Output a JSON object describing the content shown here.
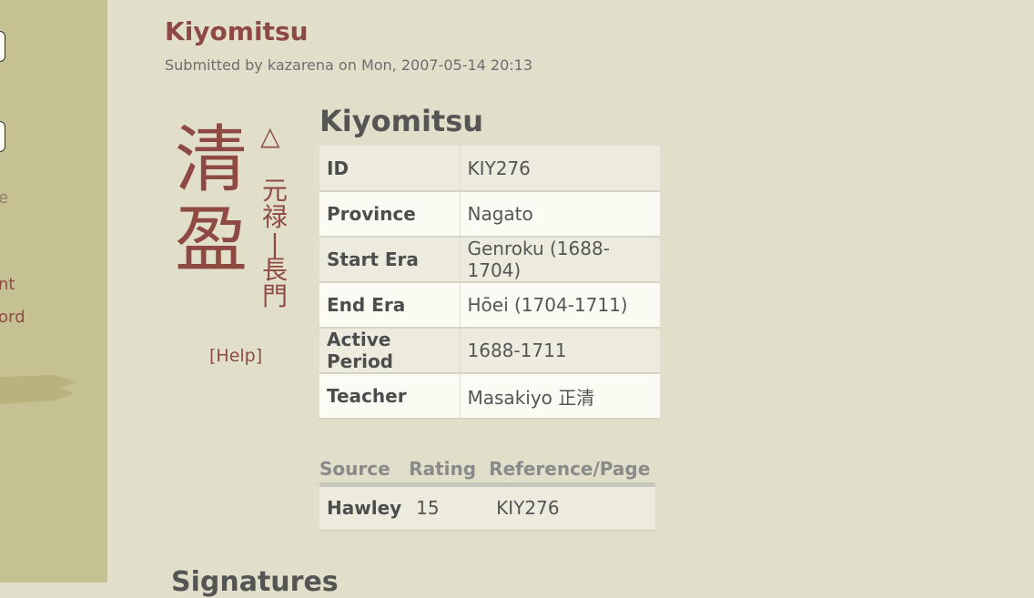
{
  "sidebar": {
    "link_partial_1": "e",
    "link_partial_2": "nt",
    "link_partial_3": "ord"
  },
  "page": {
    "title": "Kiyomitsu",
    "submitted": "Submitted by kazarena on Mon, 2007-05-14 20:13"
  },
  "signature_image": {
    "main": [
      "清",
      "盈"
    ],
    "triangle": "△",
    "vertical": [
      "元",
      "禄",
      "|",
      "長",
      "門"
    ],
    "help": "[Help]"
  },
  "entry": {
    "heading": "Kiyomitsu",
    "rows": [
      {
        "label": "ID",
        "value": "KIY276"
      },
      {
        "label": "Province",
        "value": "Nagato"
      },
      {
        "label": "Start Era",
        "value": "Genroku (1688-1704)"
      },
      {
        "label": "End Era",
        "value": "Hōei (1704-1711)"
      },
      {
        "label": "Active Period",
        "value": "1688-1711"
      },
      {
        "label": "Teacher",
        "value": "Masakiyo 正清"
      }
    ]
  },
  "references": {
    "headers": {
      "source": "Source",
      "rating": "Rating",
      "reference": "Reference/Page"
    },
    "rows": [
      {
        "source": "Hawley",
        "rating": "15",
        "reference": "KIY276"
      }
    ]
  },
  "signatures_heading": "Signatures"
}
